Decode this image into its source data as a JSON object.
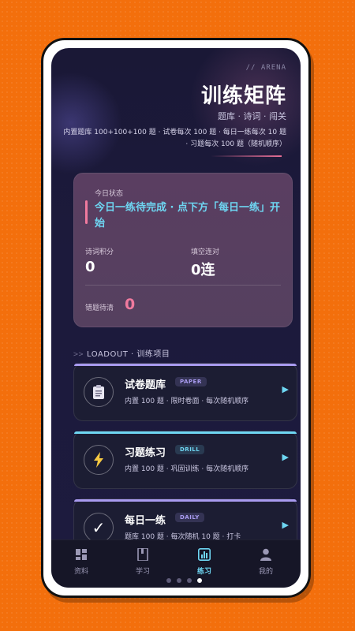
{
  "header": {
    "tag": "// ARENA",
    "title": "训练矩阵",
    "subtitle": "题库 · 诗词 · 闯关",
    "description": "内置题库 100+100+100 题 · 试卷每次 100 题 · 每日一练每次 10 题 · 习题每次 100 题（随机顺序）"
  },
  "status": {
    "label": "今日状态",
    "message": "今日一练待完成 · 点下方「每日一练」开始",
    "poetry_points_label": "诗词积分",
    "poetry_points_value": "0",
    "streak_label": "填空连对",
    "streak_value": "0连",
    "wrong_label": "错题待清",
    "wrong_value": "0"
  },
  "loadout": {
    "arrows": ">>",
    "title": "LOADOUT · 训练项目"
  },
  "cards": [
    {
      "name": "试卷题库",
      "badge": "PAPER",
      "desc": "内置 100 题 · 限时卷面 · 每次随机顺序",
      "icon": "clipboard-icon",
      "accent": "#a99bf0"
    },
    {
      "name": "习题练习",
      "badge": "DRILL",
      "desc": "内置 100 题 · 巩固训练 · 每次随机顺序",
      "icon": "lightning-icon",
      "accent": "#6ed6f2"
    },
    {
      "name": "每日一练",
      "badge": "DAILY",
      "desc": "题库 100 题 · 每次随机 10 题 · 打卡",
      "icon": "checkmark-icon",
      "accent": "#a99bf0"
    }
  ],
  "tabs": [
    {
      "label": "资料",
      "icon": "grid-icon"
    },
    {
      "label": "学习",
      "icon": "book-icon"
    },
    {
      "label": "练习",
      "icon": "chart-icon"
    },
    {
      "label": "我的",
      "icon": "user-icon"
    }
  ],
  "active_tab": "练习",
  "colors": {
    "cyan": "#6ed6f2",
    "pink": "#f07a9e",
    "lavender": "#a99bf0"
  }
}
